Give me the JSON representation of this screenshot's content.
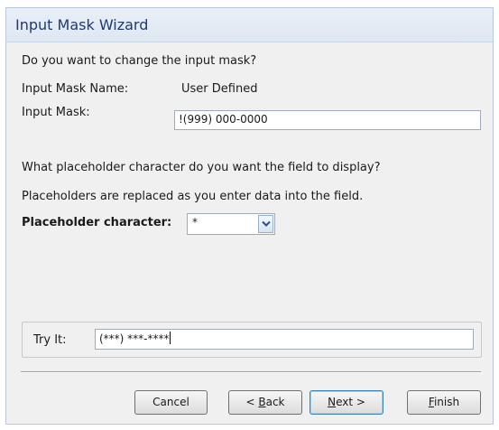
{
  "window": {
    "title": "Input Mask Wizard"
  },
  "prompt": {
    "question": "Do you want to change the input mask?",
    "mask_name_label": "Input Mask Name:",
    "mask_name_value": "User Defined",
    "mask_label": "Input Mask:",
    "mask_value": "!(999) 000-0000"
  },
  "placeholder": {
    "question": "What placeholder character do you want the field to display?",
    "note": "Placeholders are replaced as you enter data into the field.",
    "label": "Placeholder character:",
    "value": "*"
  },
  "try_it": {
    "label": "Try It:",
    "value": "(***) ***-****"
  },
  "buttons": {
    "cancel": "Cancel",
    "back_prefix": "< ",
    "back_mnemonic": "B",
    "back_rest": "ack",
    "next_mnemonic": "N",
    "next_rest": "ext >",
    "finish_mnemonic": "F",
    "finish_rest": "inish"
  },
  "colors": {
    "title_text": "#1e3b70",
    "dialog_background": "#f0f0f0",
    "default_button_border": "#3c7fb1"
  },
  "icons": {
    "combo_arrow": "chevron-down-icon"
  }
}
